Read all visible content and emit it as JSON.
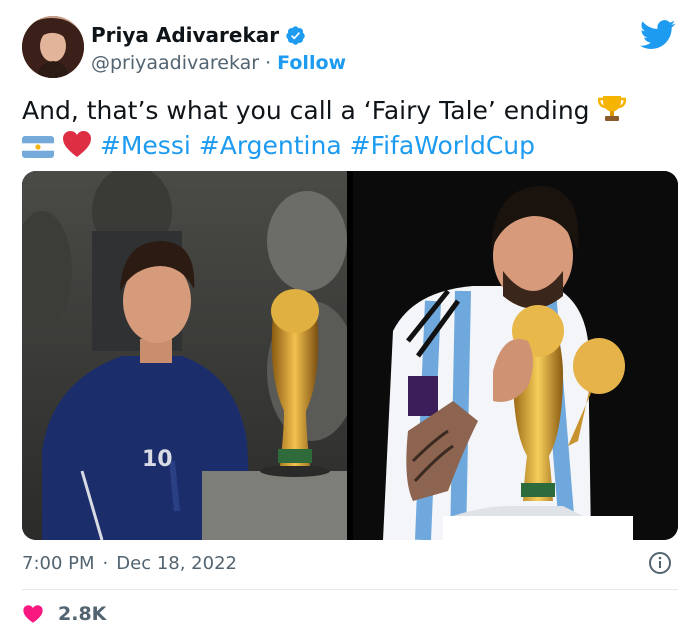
{
  "user": {
    "name": "Priya Adivarekar",
    "handle": "@priyaadivarekar",
    "separator": "·",
    "follow_label": "Follow",
    "verified_icon": "verified-badge-icon"
  },
  "platform_icon": "twitter-bird-icon",
  "tweet": {
    "text": "And, that’s what you call a ‘Fairy Tale’ ending",
    "emojis": [
      "trophy-emoji",
      "argentina-flag-emoji",
      "red-heart-emoji"
    ],
    "hashtags": [
      "#Messi",
      "#Argentina",
      "#FifaWorldCup"
    ]
  },
  "media": [
    {
      "alt_icon": "photo-messi-looking-at-trophy"
    },
    {
      "alt_icon": "photo-messi-kissing-trophy"
    }
  ],
  "meta": {
    "time": "7:00 PM",
    "separator": "·",
    "date": "Dec 18, 2022",
    "info_icon": "info-icon"
  },
  "engagement": {
    "likes": "2.8K",
    "like_icon": "heart-icon"
  },
  "colors": {
    "accent": "#1d9bf0",
    "text": "#0f1419",
    "muted": "#536471",
    "like": "#f91880",
    "divider": "#e7e9ea"
  }
}
